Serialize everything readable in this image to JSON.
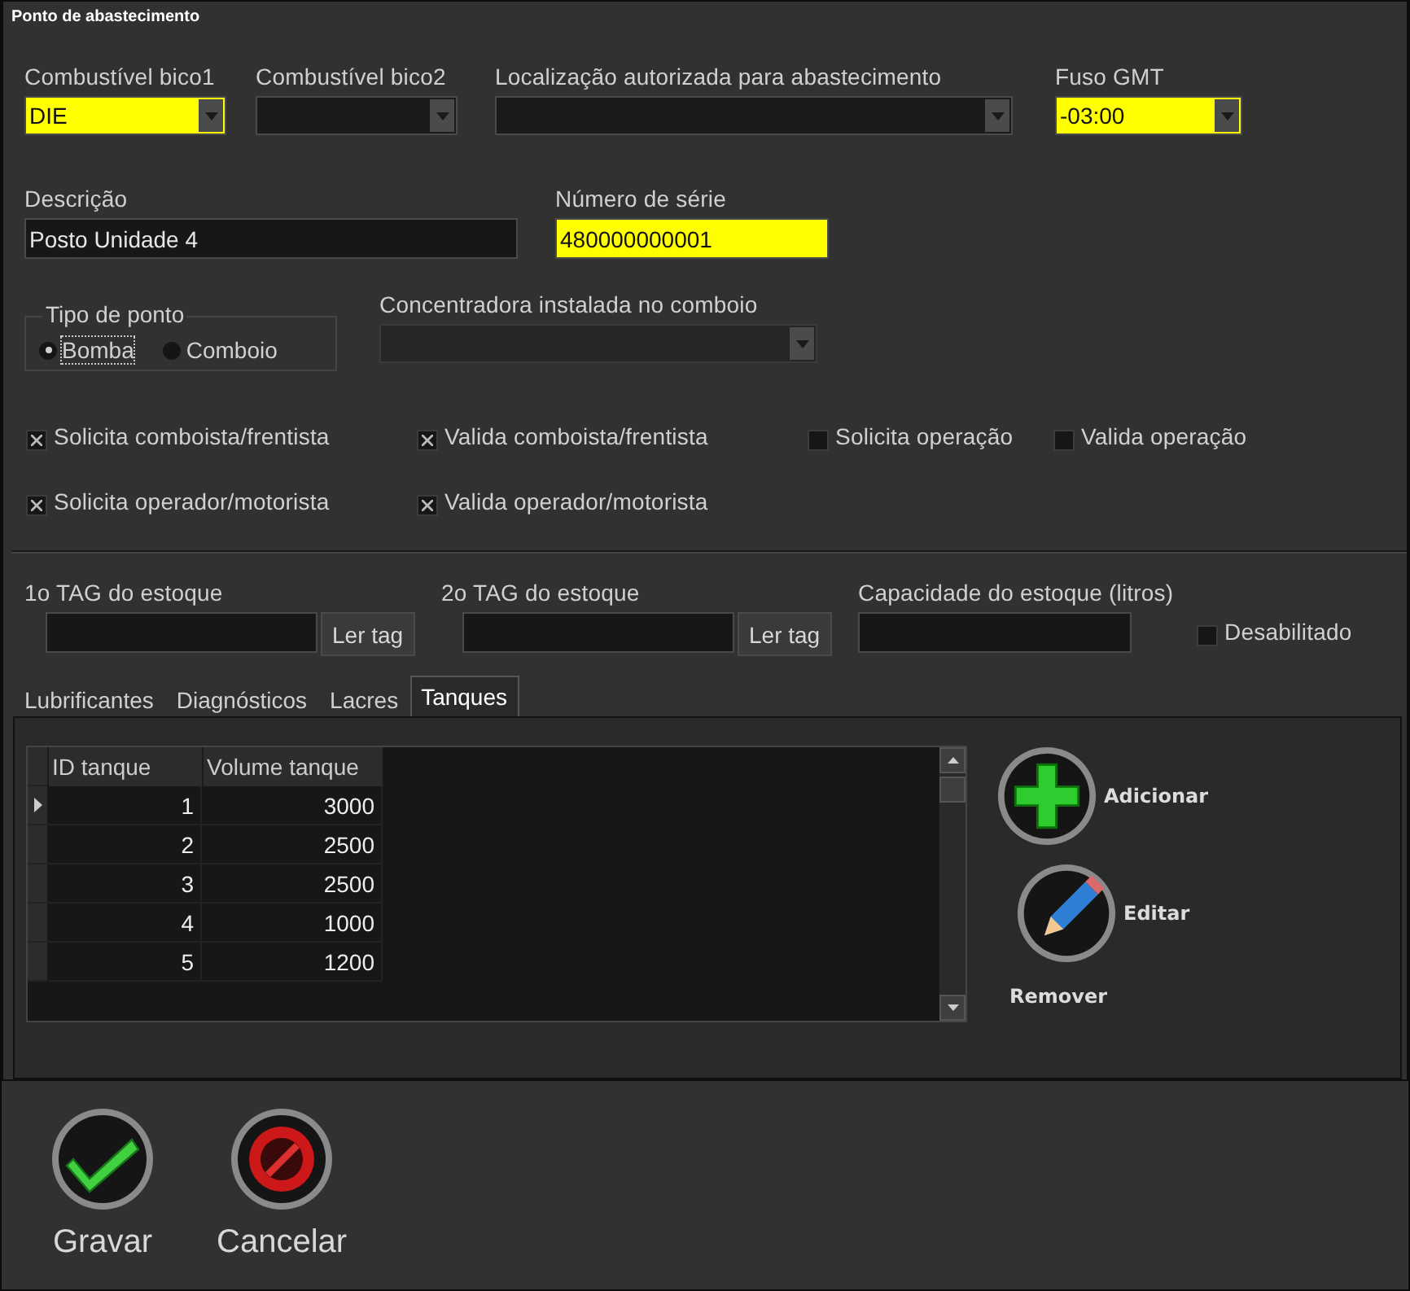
{
  "group_title": "Ponto de abastecimento",
  "combos": [
    {
      "label": "Combustível bico1",
      "value": "DIE",
      "highlighted": true
    },
    {
      "label": "Combustível bico2",
      "highlighted": false
    },
    {
      "label": "Localização autorizada para abastecimento",
      "highlighted": false
    },
    {
      "label": "Fuso GMT",
      "value": "-03:00",
      "highlighted": true
    }
  ],
  "fields": [
    {
      "label": "Descrição",
      "value": "Posto Unidade 4",
      "highlighted": false
    },
    {
      "label": "Número de série",
      "value": "480000000001",
      "highlighted": true
    }
  ],
  "point_type": {
    "label": "Tipo de ponto",
    "options": [
      {
        "label": "Bomba",
        "selected": true
      },
      {
        "label": "Comboio",
        "selected": false
      }
    ]
  },
  "concentrator": {
    "label": "Concentradora instalada no comboio",
    "disabled": true
  },
  "checkbox_rows": [
    [
      {
        "label": "Solicita comboista/frentista",
        "checked": true
      },
      {
        "label": "Valida comboista/frentista",
        "checked": true
      },
      {
        "label": "Solicita operação",
        "checked": false
      },
      {
        "label": "Valida operação",
        "checked": false
      }
    ],
    [
      {
        "label": "Solicita operador/motorista",
        "checked": true
      },
      {
        "label": "Valida operador/motorista",
        "checked": true
      }
    ]
  ],
  "tags": [
    {
      "label": "1o TAG do estoque",
      "button": "Ler tag"
    },
    {
      "label": "2o TAG do estoque",
      "button": "Ler tag"
    }
  ],
  "capacity": {
    "label": "Capacidade do estoque (litros)"
  },
  "disabled_checkbox": {
    "label": "Desabilitado",
    "checked": false
  },
  "tabs": [
    {
      "label": "Lubrificantes",
      "selected": false
    },
    {
      "label": "Diagnósticos",
      "selected": false
    },
    {
      "label": "Lacres",
      "selected": false
    },
    {
      "label": "Tanques",
      "selected": true
    }
  ],
  "grid": {
    "columns": [
      "ID tanque",
      "Volume tanque"
    ],
    "rows": [
      {
        "cells": [
          "1",
          "3000"
        ],
        "selected": true
      },
      {
        "cells": [
          "2",
          "2500"
        ],
        "selected": false
      },
      {
        "cells": [
          "3",
          "2500"
        ],
        "selected": false
      },
      {
        "cells": [
          "4",
          "1000"
        ],
        "selected": false
      },
      {
        "cells": [
          "5",
          "1200"
        ],
        "selected": false
      }
    ]
  },
  "side_actions": [
    {
      "label": "Adicionar",
      "kind": "add"
    },
    {
      "label": "Editar",
      "kind": "edit"
    },
    {
      "label": "Remover",
      "kind": "text"
    }
  ],
  "footer_actions": [
    {
      "label": "Gravar",
      "kind": "save"
    },
    {
      "label": "Cancelar",
      "kind": "cancel"
    }
  ]
}
